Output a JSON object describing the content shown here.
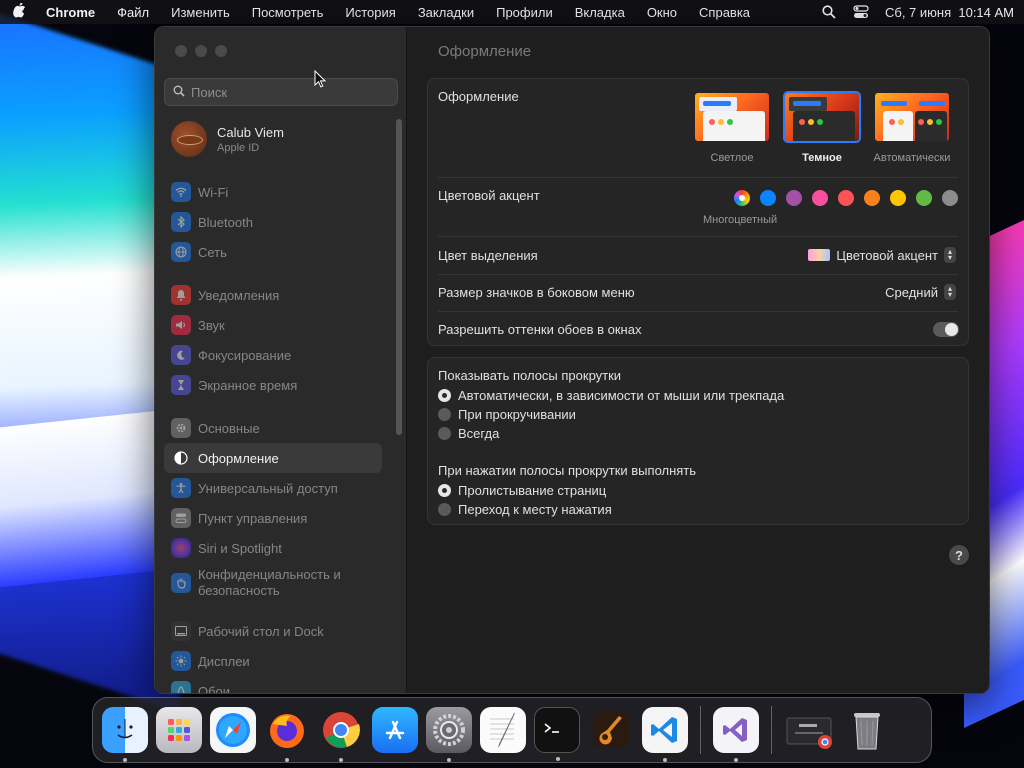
{
  "menubar": {
    "app_name": "Chrome",
    "items": [
      "Файл",
      "Изменить",
      "Посмотреть",
      "История",
      "Закладки",
      "Профили",
      "Вкладка",
      "Окно",
      "Справка"
    ],
    "datetime": "Сб, 7 июня  10:14 AM"
  },
  "sidebar": {
    "search_placeholder": "Поиск",
    "user": {
      "name": "Calub Viem",
      "subtitle": "Apple ID"
    },
    "groups": [
      [
        {
          "label": "Wi-Fi",
          "icon": "wifi-icon",
          "color": "#1e7cf2"
        },
        {
          "label": "Bluetooth",
          "icon": "bluetooth-icon",
          "color": "#1e7cf2"
        },
        {
          "label": "Сеть",
          "icon": "globe-icon",
          "color": "#1e7cf2"
        }
      ],
      [
        {
          "label": "Уведомления",
          "icon": "bell-icon",
          "color": "#ff3b30"
        },
        {
          "label": "Звук",
          "icon": "speaker-icon",
          "color": "#ff2d55"
        },
        {
          "label": "Фокусирование",
          "icon": "moon-icon",
          "color": "#5e5ce6"
        },
        {
          "label": "Экранное время",
          "icon": "hourglass-icon",
          "color": "#5e5ce6"
        }
      ],
      [
        {
          "label": "Основные",
          "icon": "gear-icon",
          "color": "#8e8e93"
        },
        {
          "label": "Оформление",
          "icon": "appearance-icon",
          "color": "#3a3a3c",
          "active": true
        },
        {
          "label": "Универсальный доступ",
          "icon": "accessibility-icon",
          "color": "#1e7cf2"
        },
        {
          "label": "Пункт управления",
          "icon": "control-center-icon",
          "color": "#8e8e93"
        },
        {
          "label": "Siri и Spotlight",
          "icon": "siri-icon",
          "color": "#bf5af2"
        },
        {
          "label": "Конфиденциальность и безопасность",
          "icon": "hand-icon",
          "color": "#1e7cf2"
        }
      ],
      [
        {
          "label": "Рабочий стол и Dock",
          "icon": "desktop-icon",
          "color": "#3a3a3c"
        },
        {
          "label": "Дисплеи",
          "icon": "display-icon",
          "color": "#1e7cf2"
        },
        {
          "label": "Обои",
          "icon": "wallpaper-icon",
          "color": "#32ade6"
        }
      ]
    ]
  },
  "main": {
    "title": "Оформление",
    "appearance_label": "Оформление",
    "themes": [
      {
        "label": "Светлое",
        "selected": false
      },
      {
        "label": "Темное",
        "selected": true
      },
      {
        "label": "Автоматически",
        "selected": false
      }
    ],
    "accent_label": "Цветовой акцент",
    "accent_colors": [
      "multicolor",
      "#0a84ff",
      "#a550a7",
      "#f74f9e",
      "#ff5257",
      "#f7821b",
      "#ffc600",
      "#62ba46",
      "#8c8c8c"
    ],
    "accent_selected_caption": "Многоцветный",
    "highlight_label": "Цвет выделения",
    "highlight_value": "Цветовой акцент",
    "icon_size_label": "Размер значков в боковом меню",
    "icon_size_value": "Средний",
    "wallpaper_tint_label": "Разрешить оттенки обоев в окнах",
    "wallpaper_tint_on": true,
    "scrollbars_title": "Показывать полосы прокрутки",
    "scrollbar_options": [
      {
        "label": "Автоматически, в зависимости от мыши или трекпада",
        "checked": true
      },
      {
        "label": "При прокручивании",
        "checked": false
      },
      {
        "label": "Всегда",
        "checked": false
      }
    ],
    "click_title": "При нажатии полосы прокрутки выполнять",
    "click_options": [
      {
        "label": "Пролистывание страниц",
        "checked": true
      },
      {
        "label": "Переход к месту нажатия",
        "checked": false
      }
    ],
    "help_label": "?"
  },
  "dock": {
    "apps": [
      "finder-icon",
      "launchpad-icon",
      "safari-icon",
      "firefox-icon",
      "chrome-icon",
      "app-store-icon",
      "system-settings-icon",
      "textedit-icon",
      "terminal-icon",
      "garageband-icon",
      "vscode-icon"
    ],
    "recent": [
      "visual-studio-icon"
    ],
    "extras": [
      "chrome-window-thumbnail-icon",
      "trash-icon"
    ]
  }
}
